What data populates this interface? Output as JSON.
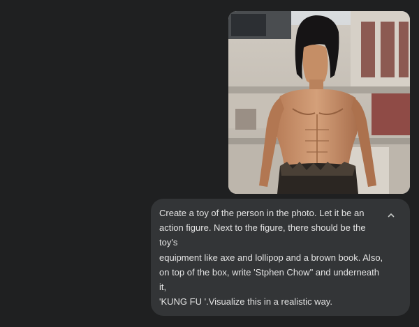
{
  "conversation": {
    "user_message": {
      "attachment": {
        "kind": "photo",
        "subject": "shirtless man with long dark hair"
      },
      "lines": [
        "Create a toy of the person in the photo. Let it be an",
        "action figure. Next to the figure, there should be the",
        "toy's",
        "equipment like axe and lollipop and a brown book. Also,",
        "on top of the box, write 'Stphen Chow\" and underneath",
        "it,",
        "'KUNG FU '.Visualize this in a realistic way."
      ],
      "collapse_icon": "chevron-up-icon"
    }
  },
  "colors": {
    "background": "#1f2021",
    "bubble": "#333537",
    "text": "#e3e3e3"
  }
}
